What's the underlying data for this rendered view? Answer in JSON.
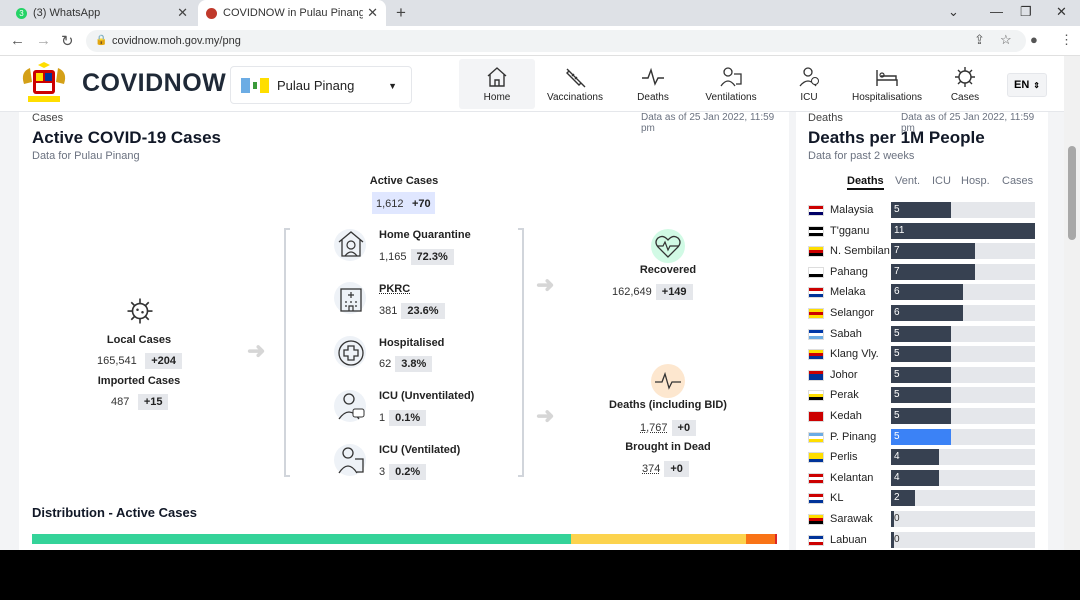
{
  "browser": {
    "tabs": [
      {
        "title": "(3) WhatsApp",
        "badge": "3"
      },
      {
        "title": "COVIDNOW in Pulau Pinang - CO"
      }
    ],
    "url": "covidnow.moh.gov.my/png"
  },
  "header": {
    "brand": "COVIDNOW",
    "state": "Pulau Pinang",
    "nav": [
      "Home",
      "Vaccinations",
      "Deaths",
      "Ventilations",
      "ICU",
      "Hospitalisations",
      "Cases"
    ],
    "lang": "EN"
  },
  "cases": {
    "section": "Cases",
    "asof": "Data as of 25 Jan 2022, 11:59 pm",
    "title": "Active COVID-19 Cases",
    "subtitle": "Data for Pulau Pinang",
    "active": {
      "label": "Active Cases",
      "value": "1,612",
      "delta": "+70"
    },
    "local": {
      "label": "Local Cases",
      "value": "165,541",
      "delta": "+204"
    },
    "imported": {
      "label": "Imported Cases",
      "value": "487",
      "delta": "+15"
    },
    "breakdown": [
      {
        "label": "Home Quarantine",
        "value": "1,165",
        "pct": "72.3%"
      },
      {
        "label": "PKRC",
        "value": "381",
        "pct": "23.6%"
      },
      {
        "label": "Hospitalised",
        "value": "62",
        "pct": "3.8%"
      },
      {
        "label": "ICU (Unventilated)",
        "value": "1",
        "pct": "0.1%"
      },
      {
        "label": "ICU (Ventilated)",
        "value": "3",
        "pct": "0.2%"
      }
    ],
    "recovered": {
      "label": "Recovered",
      "value": "162,649",
      "delta": "+149"
    },
    "deaths": {
      "label": "Deaths (including BID)",
      "value": "1,767",
      "delta": "+0"
    },
    "bid": {
      "label": "Brought in Dead",
      "value": "374",
      "delta": "+0"
    },
    "distribution_title": "Distribution - Active Cases",
    "distribution": [
      {
        "share": 72.3,
        "color": "#34d399"
      },
      {
        "share": 23.6,
        "color": "#fcd34d"
      },
      {
        "share": 3.8,
        "color": "#f97316"
      },
      {
        "share": 0.3,
        "color": "#dc2626"
      }
    ]
  },
  "deaths_panel": {
    "section": "Deaths",
    "asof": "Data as of 25 Jan 2022, 11:59 pm",
    "title": "Deaths per 1M People",
    "subtitle": "Data for past 2 weeks",
    "tabs": [
      "Deaths",
      "Vent.",
      "ICU",
      "Hosp.",
      "Cases"
    ],
    "max": 11,
    "rows": [
      {
        "name": "Malaysia",
        "value": 5,
        "flag": [
          "#cc0001",
          "#ffffff",
          "#010066"
        ]
      },
      {
        "name": "T'gganu",
        "value": 11,
        "flag": [
          "#000000",
          "#ffffff",
          "#000000"
        ]
      },
      {
        "name": "N. Sembilan",
        "value": 7,
        "flag": [
          "#ffde00",
          "#cc0000",
          "#000000"
        ]
      },
      {
        "name": "Pahang",
        "value": 7,
        "flag": [
          "#ffffff",
          "#ffffff",
          "#000000"
        ]
      },
      {
        "name": "Melaka",
        "value": 6,
        "flag": [
          "#cc0000",
          "#ffffff",
          "#003399"
        ]
      },
      {
        "name": "Selangor",
        "value": 6,
        "flag": [
          "#ffde00",
          "#cc0000",
          "#ffde00"
        ]
      },
      {
        "name": "Sabah",
        "value": 5,
        "flag": [
          "#0038a8",
          "#ffffff",
          "#6cace4"
        ]
      },
      {
        "name": "Klang Vly.",
        "value": 5,
        "flag": [
          "#ffde00",
          "#cc0000",
          "#003399"
        ]
      },
      {
        "name": "Johor",
        "value": 5,
        "flag": [
          "#cc0000",
          "#003399",
          "#003399"
        ]
      },
      {
        "name": "Perak",
        "value": 5,
        "flag": [
          "#ffffff",
          "#ffde00",
          "#000000"
        ]
      },
      {
        "name": "Kedah",
        "value": 5,
        "flag": [
          "#cc0000",
          "#cc0000",
          "#cc0000"
        ]
      },
      {
        "name": "P. Pinang",
        "value": 5,
        "flag": [
          "#6cace4",
          "#ffffff",
          "#ffde00"
        ],
        "highlight": true
      },
      {
        "name": "Perlis",
        "value": 4,
        "flag": [
          "#ffde00",
          "#ffde00",
          "#003399"
        ]
      },
      {
        "name": "Kelantan",
        "value": 4,
        "flag": [
          "#cc0000",
          "#ffffff",
          "#cc0000"
        ]
      },
      {
        "name": "KL",
        "value": 2,
        "flag": [
          "#cc0000",
          "#ffffff",
          "#003399"
        ]
      },
      {
        "name": "Sarawak",
        "value": 0,
        "flag": [
          "#ffde00",
          "#cc0000",
          "#000000"
        ]
      },
      {
        "name": "Labuan",
        "value": 0,
        "flag": [
          "#003399",
          "#ffffff",
          "#cc0000"
        ]
      }
    ]
  }
}
